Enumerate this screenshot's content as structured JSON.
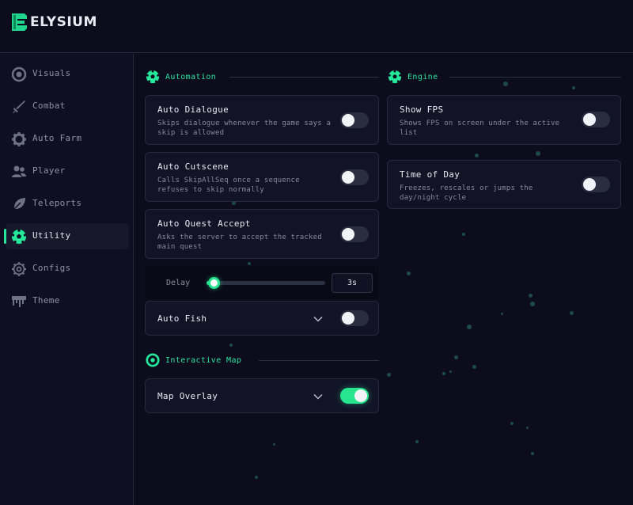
{
  "app": {
    "name": "ELYSIUM",
    "accent": "#25e89a"
  },
  "sidebar": {
    "items": [
      {
        "label": "Visuals",
        "icon": "eye-ring-icon"
      },
      {
        "label": "Combat",
        "icon": "sword-icon"
      },
      {
        "label": "Auto Farm",
        "icon": "gear-icon"
      },
      {
        "label": "Player",
        "icon": "users-icon"
      },
      {
        "label": "Teleports",
        "icon": "feather-icon"
      },
      {
        "label": "Utility",
        "icon": "soccer-ball-icon",
        "active": true
      },
      {
        "label": "Configs",
        "icon": "settings-icon"
      },
      {
        "label": "Theme",
        "icon": "paint-drip-icon"
      }
    ]
  },
  "sections": {
    "automation": {
      "title": "Automation",
      "auto_dialogue": {
        "title": "Auto Dialogue",
        "desc_line1": "Skips dialogue whenever the game says a",
        "desc_line2": "skip is allowed",
        "enabled": false
      },
      "auto_cutscene": {
        "title": "Auto Cutscene",
        "desc_line1": "Calls SkipAllSeq once a sequence",
        "desc_line2": "refuses to skip normally",
        "enabled": false
      },
      "auto_quest": {
        "title": "Auto Quest Accept",
        "desc_line1": "Asks the server to accept the tracked",
        "desc_line2": "main quest",
        "enabled": false
      },
      "delay": {
        "label": "Delay",
        "value": "3s",
        "fraction": 0.06
      },
      "auto_fish": {
        "title": "Auto Fish",
        "enabled": false
      }
    },
    "engine": {
      "title": "Engine",
      "show_fps": {
        "title": "Show FPS",
        "desc_line1": "Shows FPS on screen under the active",
        "desc_line2": "list",
        "enabled": false
      },
      "time_of_day": {
        "title": "Time of Day",
        "desc_line1": "Freezes, rescales or jumps the",
        "desc_line2": "day/night cycle",
        "enabled": false
      }
    },
    "interactive_map": {
      "title": "Interactive Map",
      "map_overlay": {
        "title": "Map Overlay",
        "enabled": true
      }
    }
  }
}
